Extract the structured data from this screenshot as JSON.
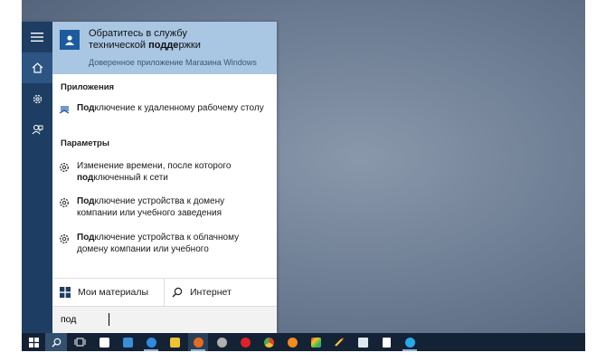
{
  "best_match": {
    "title_line1": "Обратитесь в службу",
    "title_line2_pre": "технической ",
    "title_line2_bold": "подде",
    "title_line2_post": "ржки",
    "subtitle": "Доверенное приложение Магазина Windows"
  },
  "sections": {
    "apps": "Приложения",
    "settings": "Параметры"
  },
  "apps": [
    {
      "bold": "Под",
      "rest": "ключение к удаленному рабочему столу"
    }
  ],
  "settings_items": [
    {
      "pre": "Изменение времени, после которого ",
      "bold": "под",
      "post": "ключенный к сети"
    },
    {
      "pre": "",
      "bold": "Под",
      "post": "ключение устройства к домену компании или учебного заведения"
    },
    {
      "pre": "",
      "bold": "Под",
      "post": "ключение устройства к облачному домену компании или учебного"
    }
  ],
  "bottom": {
    "my_stuff": "Мои материалы",
    "web": "Интернет"
  },
  "search": {
    "query": "под"
  },
  "colors": {
    "rail": "#1d3e62",
    "highlight": "#a9c6e2",
    "taskbar": "#142235"
  },
  "taskbar_icons": [
    {
      "name": "store-icon",
      "color": "#ffffff"
    },
    {
      "name": "news-icon",
      "color": "#3b8ed8"
    },
    {
      "name": "edge-icon",
      "color": "#2f8be0"
    },
    {
      "name": "explorer-icon",
      "color": "#f1c232"
    },
    {
      "name": "firefox-icon",
      "color": "#e66b1f"
    },
    {
      "name": "media-icon",
      "color": "#b0b0b0"
    },
    {
      "name": "opera-icon",
      "color": "#e0202a"
    },
    {
      "name": "chrome-icon",
      "color": "#4caf50"
    },
    {
      "name": "avast-icon",
      "color": "#f28c1c"
    },
    {
      "name": "paint-icon",
      "color": "#3fbf3f"
    },
    {
      "name": "pencil-icon",
      "color": "#f5c542"
    },
    {
      "name": "notepad-icon",
      "color": "#dfe8ee"
    },
    {
      "name": "document-icon",
      "color": "#ffffff"
    },
    {
      "name": "skype-icon",
      "color": "#29a9ea"
    }
  ]
}
